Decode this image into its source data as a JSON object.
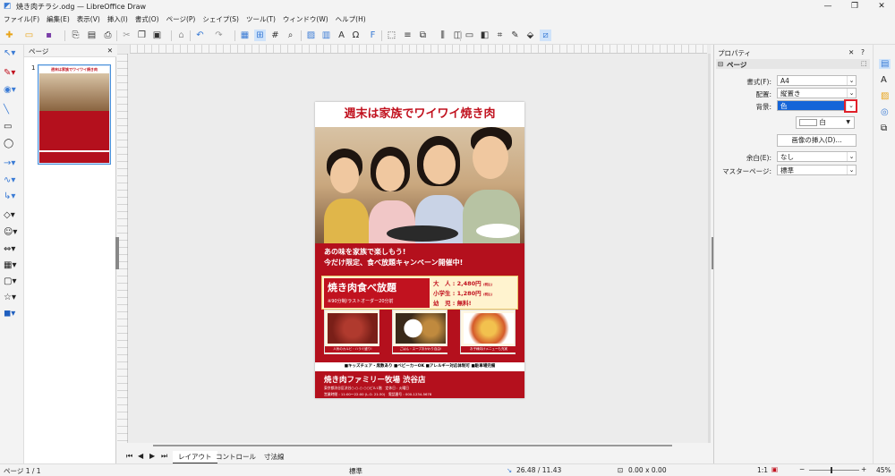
{
  "window": {
    "title": "焼き肉チラシ.odg — LibreOffice Draw",
    "controls": [
      "—",
      "❐",
      "✕"
    ]
  },
  "menu": [
    "ファイル(F)",
    "編集(E)",
    "表示(V)",
    "挿入(I)",
    "書式(O)",
    "ページ(P)",
    "シェイプ(S)",
    "ツール(T)",
    "ウィンドウ(W)",
    "ヘルプ(H)"
  ],
  "pages_pane": {
    "title": "ページ",
    "page_number": "1"
  },
  "flyer": {
    "title": "週末は家族でワイワイ焼き肉",
    "line1": "あの味を家族で楽しもう!",
    "line2": "今だけ限定、食べ放題キャンペーン開催中!",
    "offer_name": "焼き肉食べ放題",
    "offer_note": "※90分制/ラストオーダー20分前",
    "price_adult": "大　人 : 2,480円",
    "price_adult_tax": "(税込)",
    "price_child": "小学生 : 1,280円",
    "price_child_tax": "(税込)",
    "price_infant": "幼　児 : 無料!",
    "food_captions": [
      "人気のカルビ・ハラミ盛り!",
      "ごはん・スープおかわり自由!",
      "お子様向けメニューも充実"
    ],
    "features": "■キッズチェア・席数あり ■ベビーカーOK ■アレルギー対応体制可 ■駐車場完備",
    "store_name": "焼き肉ファミリー牧場 渋谷店",
    "address": "東京都渋谷区渋谷○-○-○ ○○ビル1階　定休日 : 火曜日",
    "hours": "営業時間 : 11:00〜22:00 (L.O. 21:30)　電話番号 : 000-1234-5678"
  },
  "tabs": [
    "レイアウト",
    "コントロール",
    "寸法線"
  ],
  "properties": {
    "panel_title": "プロパティ",
    "section_title": "ページ",
    "format_label": "書式(F):",
    "format_value": "A4",
    "orientation_label": "配置:",
    "orientation_value": "縦置き",
    "background_label": "背景:",
    "background_value": "色",
    "color_value": "白",
    "insert_image_button": "画像の挿入(D)...",
    "margin_label": "余白(E):",
    "margin_value": "なし",
    "master_label": "マスターページ:",
    "master_value": "標準"
  },
  "status": {
    "page": "ページ 1 / 1",
    "master": "標準",
    "position": "26.48 / 11.43",
    "size": "0.00 x 0.00",
    "scale": "1:1",
    "zoom": "45%"
  },
  "colors": {
    "flyer_red": "#b4101d",
    "accent_blue": "#3a7bd5",
    "highlight_red": "#e0202a"
  }
}
